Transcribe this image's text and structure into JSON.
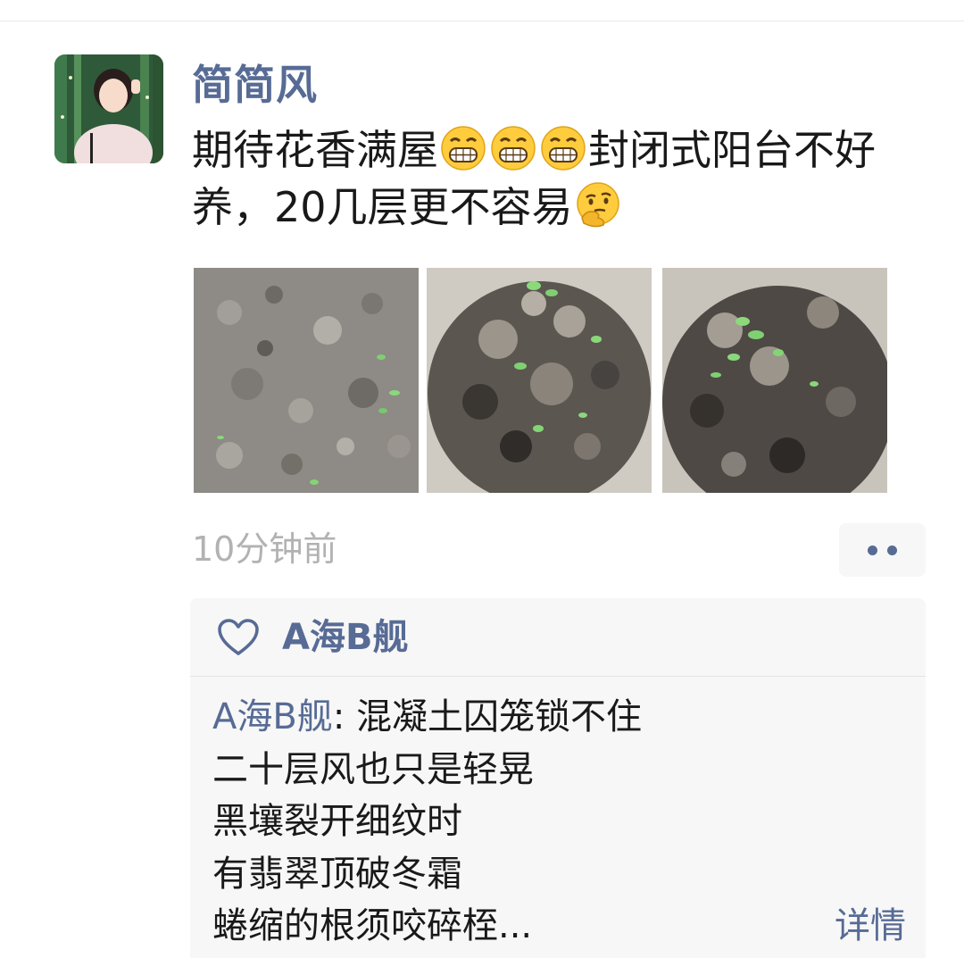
{
  "post": {
    "author": "简简风",
    "text_part1": "期待花香满屋",
    "text_part2": "封闭式阳台不好养，20几层更不容易",
    "emojis": [
      "grin-emoji",
      "grin-emoji",
      "grin-emoji",
      "thinking-emoji"
    ],
    "time": "10分钟前"
  },
  "likes": {
    "users": [
      "A海B舰"
    ]
  },
  "comments": [
    {
      "name": "A海B舰",
      "separator": ": ",
      "lines": [
        "混凝土囚笼锁不住",
        "二十层风也只是轻晃",
        "黑壤裂开细纹时",
        "有翡翠顶破冬霜",
        "蜷缩的根须咬碎桎..."
      ]
    }
  ],
  "detail_label": "详情",
  "colors": {
    "link": "#576b95",
    "timestamp": "#b2b2b2",
    "comment_bg": "#f7f7f7"
  }
}
